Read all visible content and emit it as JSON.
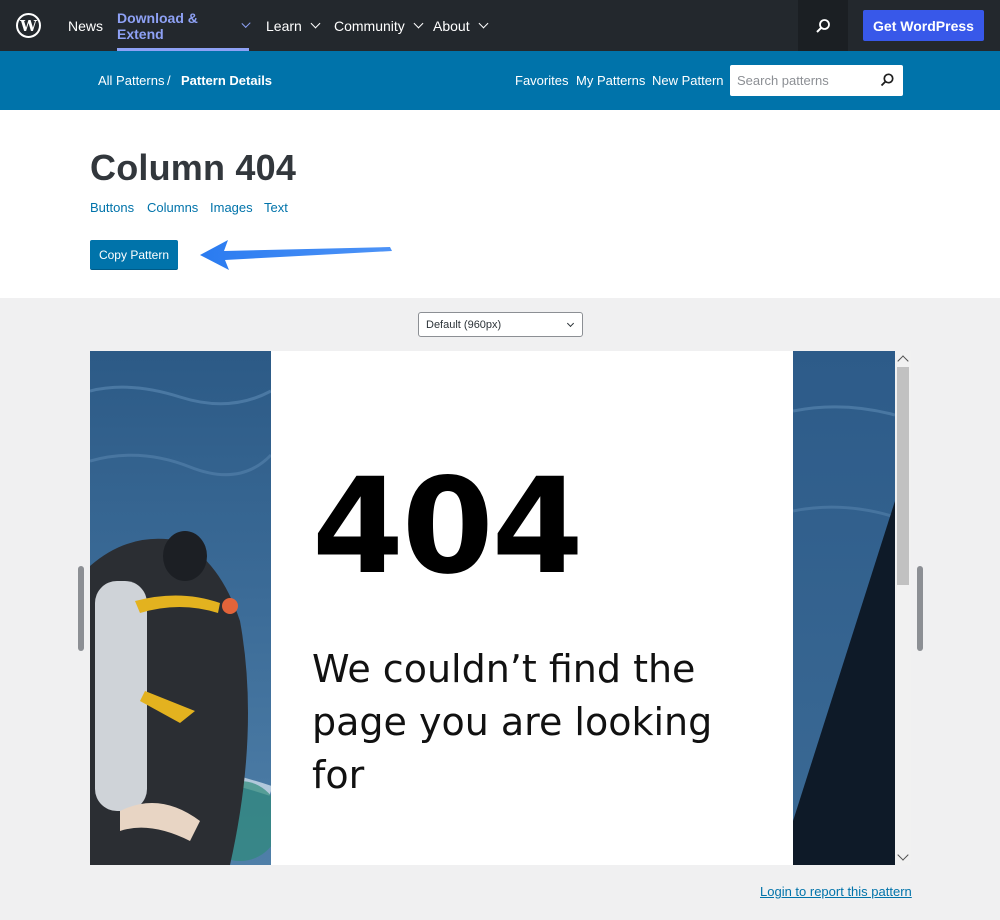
{
  "nav": {
    "logo_glyph": "W",
    "items": [
      {
        "label": "News"
      },
      {
        "label": "Download & Extend"
      },
      {
        "label": "Learn"
      },
      {
        "label": "Community"
      },
      {
        "label": "About"
      }
    ],
    "active_item": "Download & Extend",
    "search_icon": "search-icon",
    "cta_label": "Get WordPress",
    "cta_color": "#3858e9",
    "bg_color": "#23282d",
    "active_color": "#8ea1f5"
  },
  "subnav": {
    "breadcrumb": {
      "root": "All Patterns",
      "separator": "/",
      "current": "Pattern Details"
    },
    "links": [
      {
        "label": "Favorites"
      },
      {
        "label": "My Patterns"
      },
      {
        "label": "New Pattern"
      }
    ],
    "search": {
      "placeholder": "Search patterns",
      "value": "",
      "icon": "search-icon"
    },
    "bg_color": "#0073aa"
  },
  "pattern": {
    "title": "Column 404",
    "tags": [
      "Buttons",
      "Columns",
      "Images",
      "Text"
    ],
    "copy_label": "Copy Pattern",
    "annotation": "arrow-pointing-to-copy-button"
  },
  "preview": {
    "viewport_selected": "Default (960px)",
    "heading": "404",
    "message": "We couldn’t find the page you are looking for",
    "left_image": "scuba-diver-on-boat-photo",
    "right_image": "ocean-water-photo"
  },
  "footer": {
    "report_link": "Login to report this pattern"
  }
}
